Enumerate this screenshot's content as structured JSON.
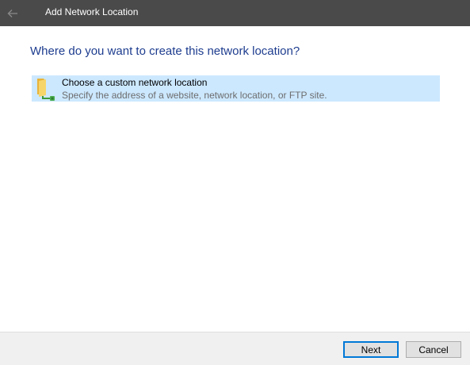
{
  "window": {
    "title": "Add Network Location"
  },
  "header": {
    "question": "Where do you want to create this network location?"
  },
  "options": [
    {
      "title": "Choose a custom network location",
      "description": "Specify the address of a website, network location, or FTP site.",
      "icon": "network-folder-icon",
      "selected": true
    }
  ],
  "footer": {
    "next_label": "Next",
    "cancel_label": "Cancel"
  },
  "colors": {
    "titlebar": "#4a4a4a",
    "heading": "#1e3d8f",
    "selection": "#cce8ff",
    "default_button_border": "#0078d7"
  }
}
